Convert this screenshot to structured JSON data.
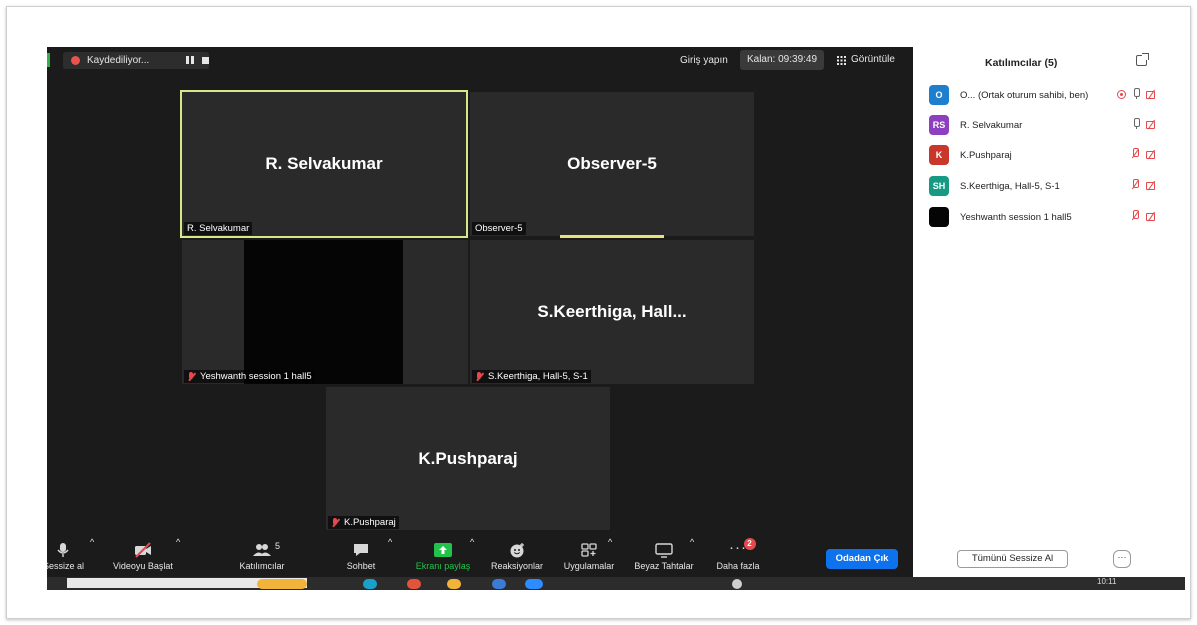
{
  "topbar": {
    "recording_label": "Kaydediliyor...",
    "login_label": "Giriş yapın",
    "timer_label": "Kalan: 09:39:49",
    "view_label": "Görüntüle"
  },
  "tiles": [
    {
      "name": "R. Selvakumar",
      "tag": "R. Selvakumar"
    },
    {
      "name": "Observer-5",
      "tag": "Observer-5"
    },
    {
      "name": "",
      "tag": "Yeshwanth session 1 hall5"
    },
    {
      "name": "S.Keerthiga,  Hall...",
      "tag": "S.Keerthiga, Hall-5, S-1"
    },
    {
      "name": "K.Pushparaj",
      "tag": "K.Pushparaj"
    }
  ],
  "toolbar": {
    "mute": "Sessize al",
    "video": "Videoyu Başlat",
    "participants": "Katılımcılar",
    "participants_count": "5",
    "chat": "Sohbet",
    "share": "Ekranı paylaş",
    "reactions": "Reaksiyonlar",
    "apps": "Uygulamalar",
    "whiteboards": "Beyaz Tahtalar",
    "more": "Daha fazla",
    "more_badge": "2",
    "leave": "Odadan Çık"
  },
  "panel": {
    "title": "Katılımcılar (5)",
    "participants": [
      {
        "initials": "O",
        "name": "O... (Ortak oturum sahibi, ben)",
        "color": "#1f7fcf"
      },
      {
        "initials": "RS",
        "name": "R. Selvakumar",
        "color": "#8e3fc0"
      },
      {
        "initials": "K",
        "name": "K.Pushparaj",
        "color": "#c9362b"
      },
      {
        "initials": "SH",
        "name": "S.Keerthiga, Hall-5, S-1",
        "color": "#169a83"
      },
      {
        "initials": "",
        "name": "Yeshwanth session 1 hall5",
        "color": "#050505"
      }
    ],
    "mute_all": "Tümünü Sessize Al",
    "more": "···"
  },
  "taskbar": {
    "clock": "10:11"
  },
  "colors": {
    "accent": "#0e72ed",
    "active_speaker": "#d6e88a",
    "share_green": "#23c24a",
    "muted_red": "#e5484d"
  }
}
